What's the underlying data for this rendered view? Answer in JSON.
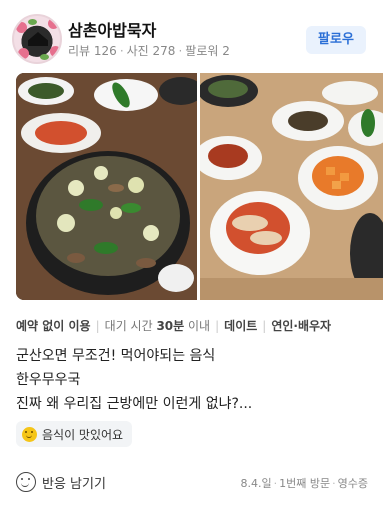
{
  "profile": {
    "name": "삼촌아밥묵자",
    "reviews_label": "리뷰 126",
    "photos_label": "사진 278",
    "followers_label": "팔로워 2",
    "follow_button": "팔로우"
  },
  "tags": [
    "예약 없이 이용",
    "대기 시간 30분 이내",
    "데이트",
    "연인·배우자"
  ],
  "review_lines": [
    "군산오면 무조건! 먹어야되는 음식",
    "한우무우국",
    "진짜 왜 우리집 근방에만 이런게 없냐?..."
  ],
  "keyword_chip": "음식이 맛있어요",
  "footer": {
    "react_label": "반응 남기기",
    "visit_date": "8.4.일",
    "visit_count": "1번째 방문",
    "receipt": "영수증"
  },
  "icons": {
    "avatar": "restaurant-logo",
    "chip": "smile-emoji-icon",
    "react": "smile-outline-icon"
  },
  "colors": {
    "follow_bg": "#eaf2fd",
    "follow_text": "#2b6fd6",
    "chip_bg": "#f2f4f6"
  }
}
